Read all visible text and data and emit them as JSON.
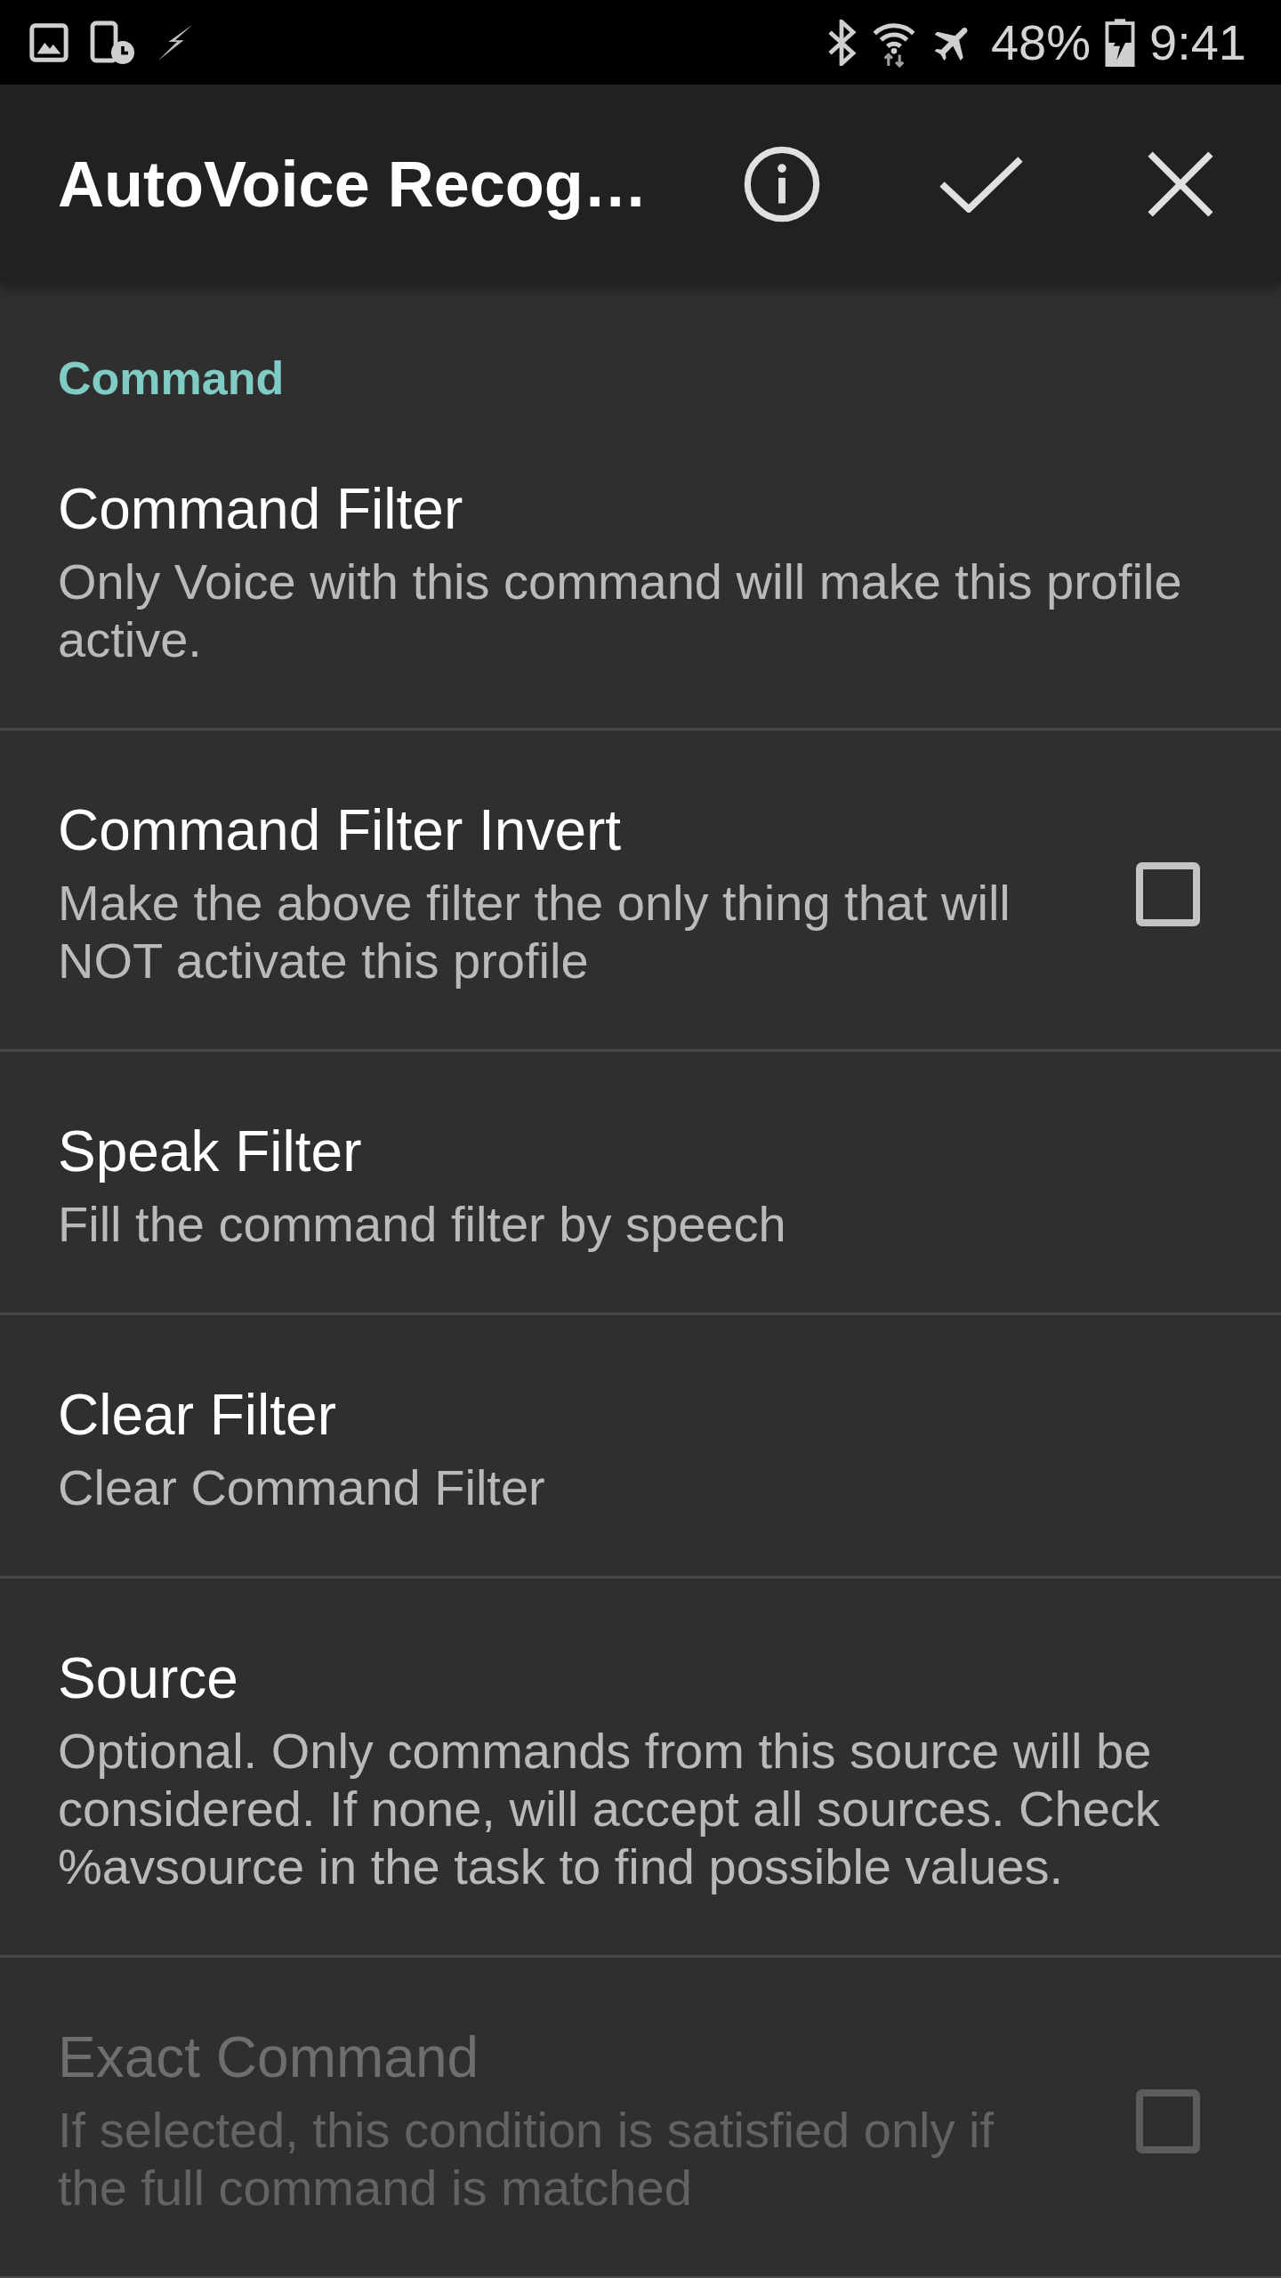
{
  "status_bar": {
    "battery": "48%",
    "time": "9:41"
  },
  "app_bar": {
    "title": "AutoVoice Recog…"
  },
  "sections": [
    {
      "header": "Command",
      "items": [
        {
          "kind": "plain",
          "title": "Command Filter",
          "summary": "Only Voice with this command will make this profile active.",
          "disabled": false
        },
        {
          "kind": "checkbox",
          "title": "Command Filter Invert",
          "summary": "Make the above filter the only thing that will NOT activate this profile",
          "checked": false,
          "disabled": false
        },
        {
          "kind": "plain",
          "title": "Speak Filter",
          "summary": "Fill the command filter by speech",
          "disabled": false
        },
        {
          "kind": "plain",
          "title": "Clear Filter",
          "summary": "Clear Command Filter",
          "disabled": false
        },
        {
          "kind": "plain",
          "title": "Source",
          "summary": "Optional. Only commands from this source will be considered. If none, will accept all sources. Check %avsource in the task to find possible values.",
          "disabled": false
        },
        {
          "kind": "checkbox",
          "title": "Exact Command",
          "summary": "If selected, this condition is satisfied only if the full command is matched",
          "checked": false,
          "disabled": true
        }
      ]
    }
  ]
}
